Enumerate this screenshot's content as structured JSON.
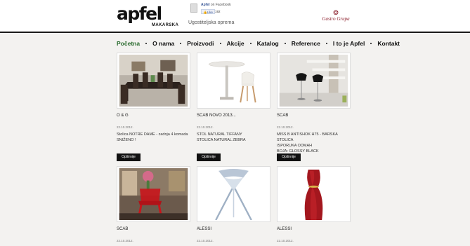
{
  "header": {
    "logo_text": "apfel",
    "logo_sub": "MAKARSKA",
    "tagline": "Ugostiteljska oprema",
    "facebook": {
      "page_name": "Apfel",
      "suffix": "on Facebook",
      "like_label": "Like",
      "like_count": "192"
    },
    "partner": {
      "name": "Gastro Grupa"
    }
  },
  "nav": {
    "items": [
      {
        "label": "Početna",
        "active": true
      },
      {
        "label": "O nama"
      },
      {
        "label": "Proizvodi"
      },
      {
        "label": "Akcije"
      },
      {
        "label": "Katalog"
      },
      {
        "label": "Reference"
      },
      {
        "label": "I to je Apfel"
      },
      {
        "label": "Kontakt"
      }
    ]
  },
  "products": [
    {
      "title": "O & G",
      "date": "22.10.2012.",
      "description_lines": [
        "Stolica NOTRE DAME - zadnja 4 komada",
        "SNIŽENO !"
      ],
      "button_label": "Opširnije",
      "image_icon": "dining-set-image"
    },
    {
      "title": "SCAB NOVO 2013...",
      "date": "22.10.2012.",
      "description_lines": [
        "STOL NATURAL TIFFANY",
        "STOLICA NATURAL ZEBRA"
      ],
      "button_label": "Opširnije",
      "image_icon": "table-chair-image"
    },
    {
      "title": "SCAB",
      "date": "22.10.2012.",
      "description_lines": [
        "MISS B ANTISHOK H75 - BARSKA STOLICA",
        "ISPORUKA ODMAH",
        "BOJA: GLOSSY BLACK"
      ],
      "button_label": "Opširnije",
      "image_icon": "bar-stools-image"
    },
    {
      "title": "SCAB",
      "date": "22.10.2012.",
      "description_lines": [],
      "button_label": "",
      "image_icon": "red-chair-image"
    },
    {
      "title": "ALESSI",
      "date": "22.10.2012.",
      "description_lines": [],
      "button_label": "",
      "image_icon": "juicer-image"
    },
    {
      "title": "ALESSI",
      "date": "22.10.2012.",
      "description_lines": [],
      "button_label": "",
      "image_icon": "red-vase-image"
    }
  ],
  "colors": {
    "accent_green": "#2a6b2e",
    "partner_red": "#8b1c2a",
    "button_black": "#111111",
    "page_bg": "#f3f2f0"
  }
}
